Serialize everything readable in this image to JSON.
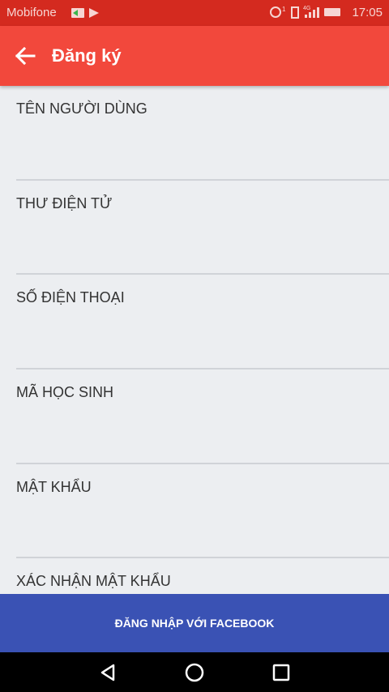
{
  "status_bar": {
    "carrier": "Mobifone",
    "time": "17:05"
  },
  "app_bar": {
    "title": "Đăng ký",
    "back_icon": "arrow-left-icon"
  },
  "form": {
    "fields": [
      {
        "label": "TÊN NGƯỜI DÙNG",
        "value": ""
      },
      {
        "label": "THƯ ĐIỆN TỬ",
        "value": ""
      },
      {
        "label": "SỐ ĐIỆN THOẠI",
        "value": ""
      },
      {
        "label": "MÃ HỌC SINH",
        "value": ""
      },
      {
        "label": "MẬT KHẨU",
        "value": ""
      },
      {
        "label": "XÁC NHẬN MẬT KHẨU",
        "value": ""
      }
    ]
  },
  "facebook_button": {
    "label": "ĐĂNG NHẬP VỚI FACEBOOK"
  },
  "colors": {
    "status_bar": "#d42a1f",
    "app_bar": "#f2483c",
    "facebook_button": "#3a52b4",
    "background": "#eceef1"
  }
}
